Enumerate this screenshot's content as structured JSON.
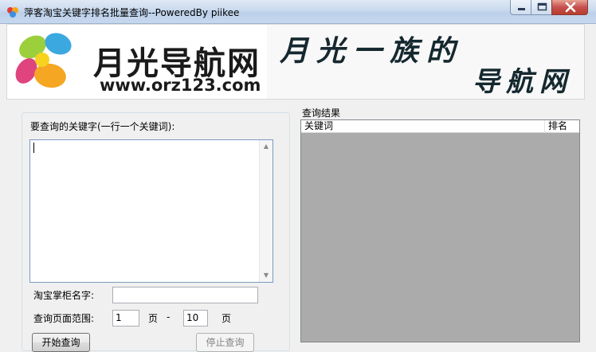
{
  "window": {
    "title": "萍客淘宝关键字排名批量查询--PoweredBy piikee",
    "icon": "app-logo-icon",
    "controls": [
      "minimize-icon",
      "maximize-icon",
      "close-icon"
    ]
  },
  "banner": {
    "brand_title": "月光导航网",
    "brand_url": "www.orz123.com",
    "art_line1": "月光一族的",
    "art_line2": "导航网"
  },
  "form": {
    "keywords_label": "要查询的关键字(一行一个关键词):",
    "keywords_value": "",
    "shop_label": "淘宝掌柜名字:",
    "shop_value": "",
    "range_label": "查询页面范围:",
    "page_from": "1",
    "page_unit": "页",
    "range_sep": "-",
    "page_to": "10",
    "start_button": "开始查询",
    "stop_button": "停止查询"
  },
  "results": {
    "label": "查询结果",
    "columns": [
      "关键词",
      "排名"
    ],
    "rows": []
  },
  "colors": {
    "list_background": "#ababab",
    "window_background": "#f0f0f0"
  }
}
